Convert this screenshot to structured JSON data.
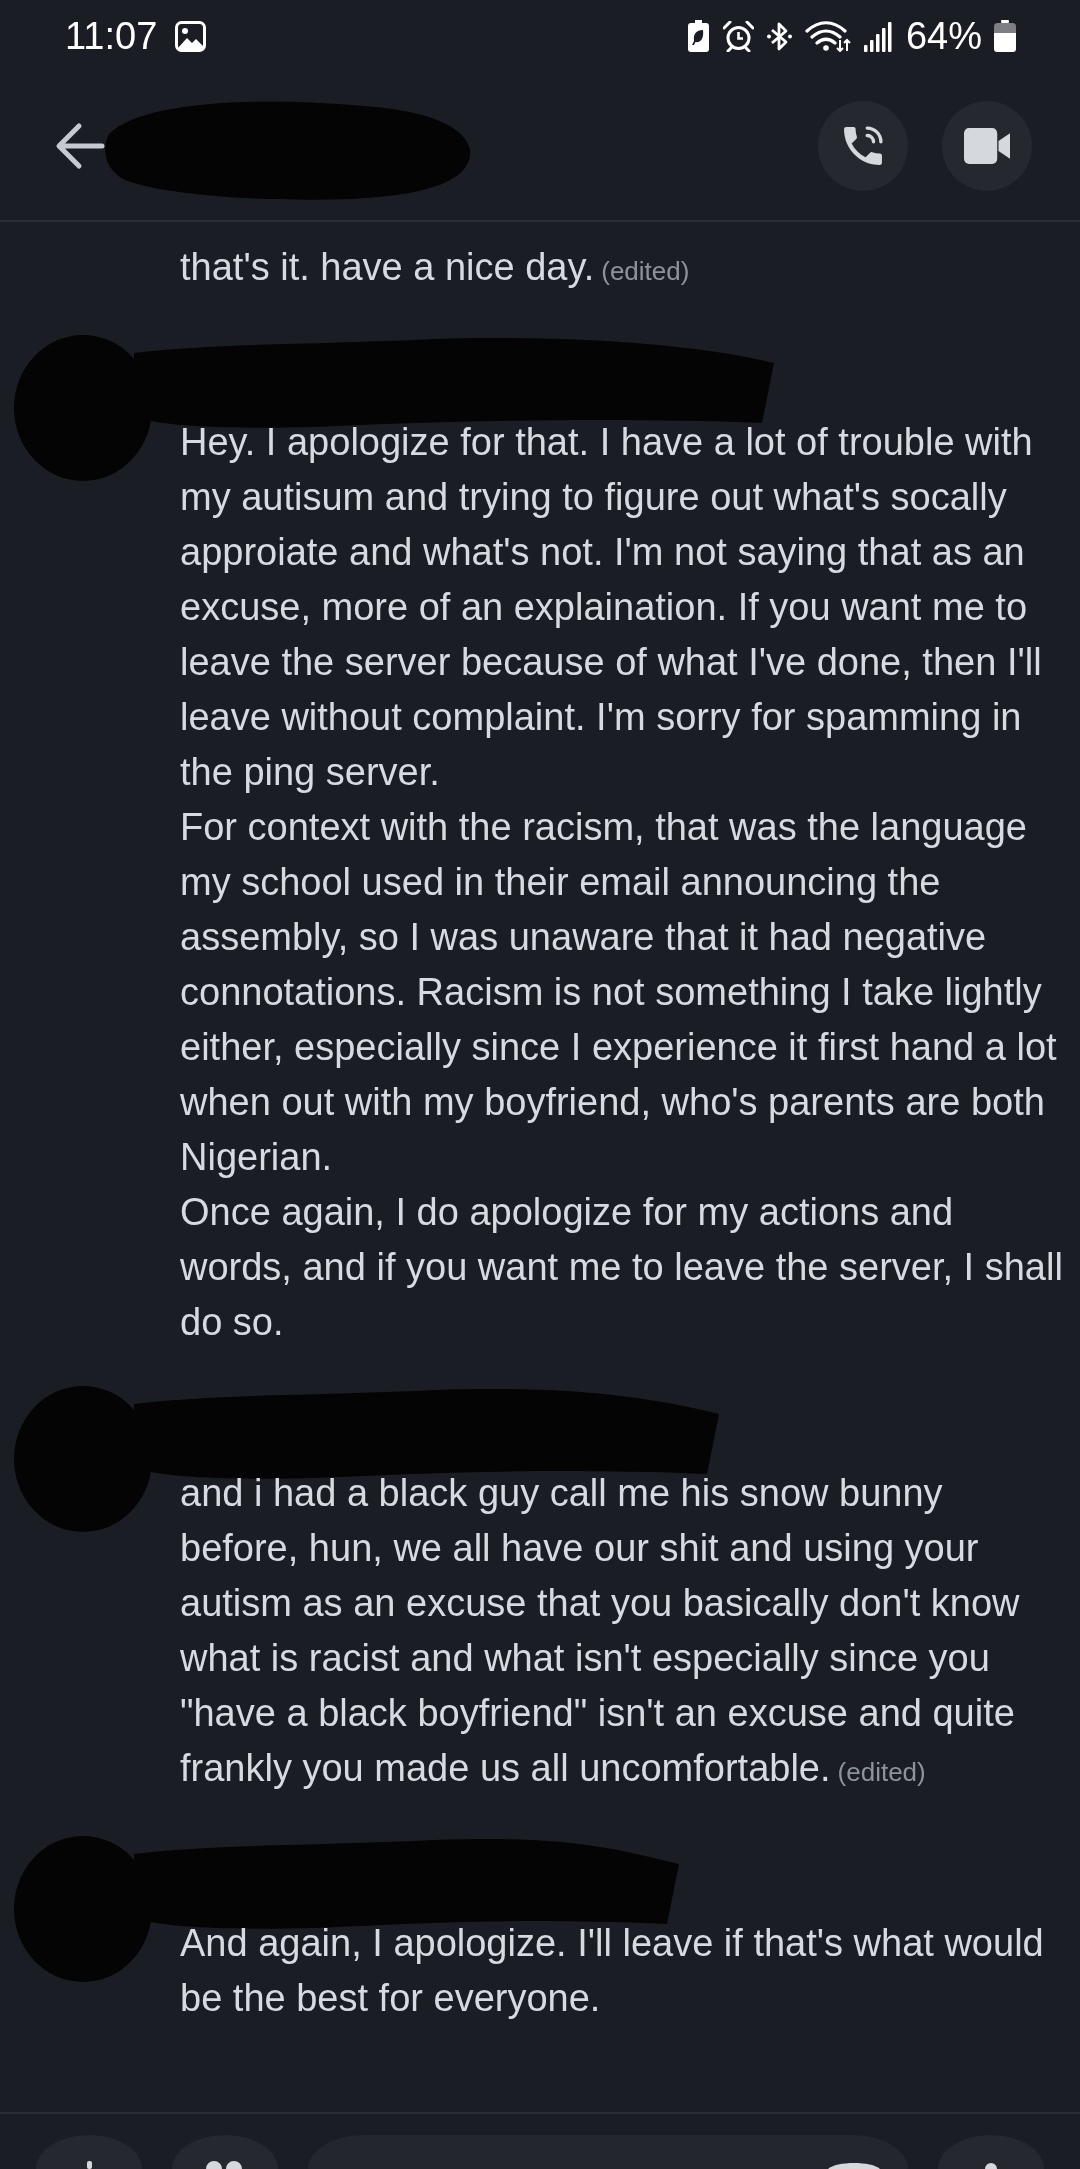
{
  "status_bar": {
    "time": "11:07",
    "battery": "64%"
  },
  "header": {
    "title_redacted": true
  },
  "messages": [
    {
      "author_redacted": false,
      "paragraphs": [
        "that's it. have a nice day."
      ],
      "edited_label": "(edited)"
    },
    {
      "author_redacted": true,
      "paragraphs": [
        "Hey. I apologize for that. I have a lot of trouble with my autisum and trying to figure out what's socally approiate and what's not. I'm not saying that as an excuse, more of an explaination. If you want me to leave the server because of what I've done, then I'll leave without complaint. I'm sorry for spamming in the ping server.",
        "For context with the racism, that was the language my school used in their email announcing the assembly, so I was unaware that it had negative connotations. Racism is not something I take lightly either, especially since I experience it first hand a lot when out with my boyfriend, who's parents are both Nigerian.",
        "Once again, I do apologize for my actions and words, and if you want me to leave the server, I shall do so."
      ]
    },
    {
      "author_redacted": true,
      "paragraphs": [
        "and i had a black guy call me his snow bunny before, hun, we all have our shit and using your autism as an excuse that you basically don't know what is racist and what isn't especially since you \"have a black boyfriend\" isn't an excuse and quite frankly you made us all uncomfortable."
      ],
      "edited_label": "(edited)"
    },
    {
      "author_redacted": true,
      "paragraphs": [
        "And again, I apologize. I'll leave if that's what would be the best for everyone."
      ]
    }
  ]
}
